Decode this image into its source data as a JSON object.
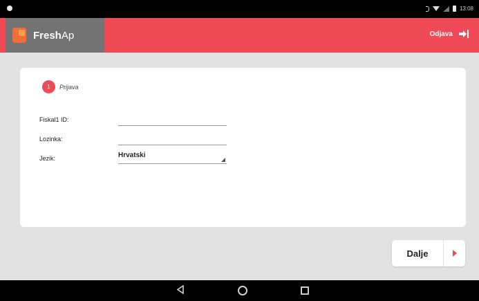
{
  "status_bar": {
    "time": "13:08"
  },
  "app_bar": {
    "brand_bold": "Fresh",
    "brand_light": "Ap",
    "logout_label": "Odjava",
    "accent_color": "#ef4a55"
  },
  "login": {
    "step_number": "1",
    "step_label": "Prijava",
    "fields": {
      "id_label": "Fiskal1 ID:",
      "id_value": "",
      "password_label": "Lozinka:",
      "password_value": "",
      "language_label": "Jezik:",
      "language_value": "Hrvatski"
    }
  },
  "actions": {
    "next_label": "Dalje"
  },
  "nav_icons": [
    "back-icon",
    "home-icon",
    "recent-apps-icon"
  ]
}
